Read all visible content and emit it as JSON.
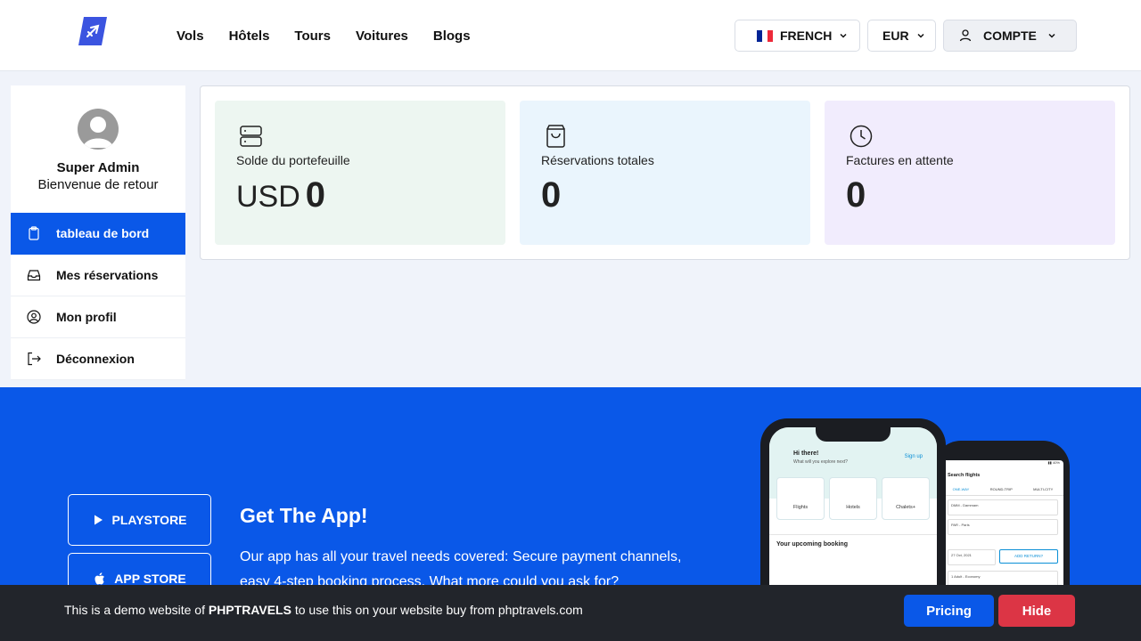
{
  "header": {
    "nav": [
      "Vols",
      "Hôtels",
      "Tours",
      "Voitures",
      "Blogs"
    ],
    "language": "FRENCH",
    "currency": "EUR",
    "account": "COMPTE"
  },
  "sidebar": {
    "user_name": "Super Admin",
    "welcome": "Bienvenue de retour",
    "items": [
      {
        "label": "tableau de bord",
        "icon": "clipboard-icon",
        "active": true
      },
      {
        "label": "Mes réservations",
        "icon": "inbox-icon",
        "active": false
      },
      {
        "label": "Mon profil",
        "icon": "user-circle-icon",
        "active": false
      },
      {
        "label": "Déconnexion",
        "icon": "logout-icon",
        "active": false
      }
    ]
  },
  "stats": {
    "wallet": {
      "label": "Solde du portefeuille",
      "currency": "USD",
      "value": "0",
      "icon": "server-icon"
    },
    "bookings": {
      "label": "Réservations totales",
      "value": "0",
      "icon": "shopping-bag-icon"
    },
    "invoices": {
      "label": "Factures en attente",
      "value": "0",
      "icon": "clock-icon"
    }
  },
  "app_banner": {
    "playstore": "PLAYSTORE",
    "appstore": "APP STORE",
    "title": "Get The App!",
    "text": "Our app has all your travel needs covered: Secure payment channels, easy 4-step booking process. What more could you ask for?",
    "phone_front": {
      "greeting": "Hi there!",
      "subtitle": "What will you explore next?",
      "signup": "Sign up",
      "tiles": [
        "Flights",
        "Hotels",
        "Chalets+"
      ],
      "upcoming": "Your upcoming booking"
    },
    "phone_back": {
      "title": "Search flights",
      "tabs": [
        "ONE-WAY",
        "ROUND-TRIP",
        "MULTI-CITY"
      ],
      "from": "DMM - Dammam",
      "to": "PAR - Paris",
      "date": "27 Oct, 2021",
      "add_return": "ADD RETURN?",
      "passengers": "1 Adult - Economy"
    }
  },
  "cookie_bar": {
    "text_before": "This is a demo website of ",
    "brand": "PHPTRAVELS",
    "text_after": " to use this on your website buy from phptravels.com",
    "pricing": "Pricing",
    "hide": "Hide"
  },
  "colors": {
    "primary": "#0a58e8",
    "danger": "#dc3545",
    "dark": "#22252b",
    "card_green": "#edf6f1",
    "card_blue": "#eaf5fd",
    "card_purple": "#f1ecfd"
  }
}
